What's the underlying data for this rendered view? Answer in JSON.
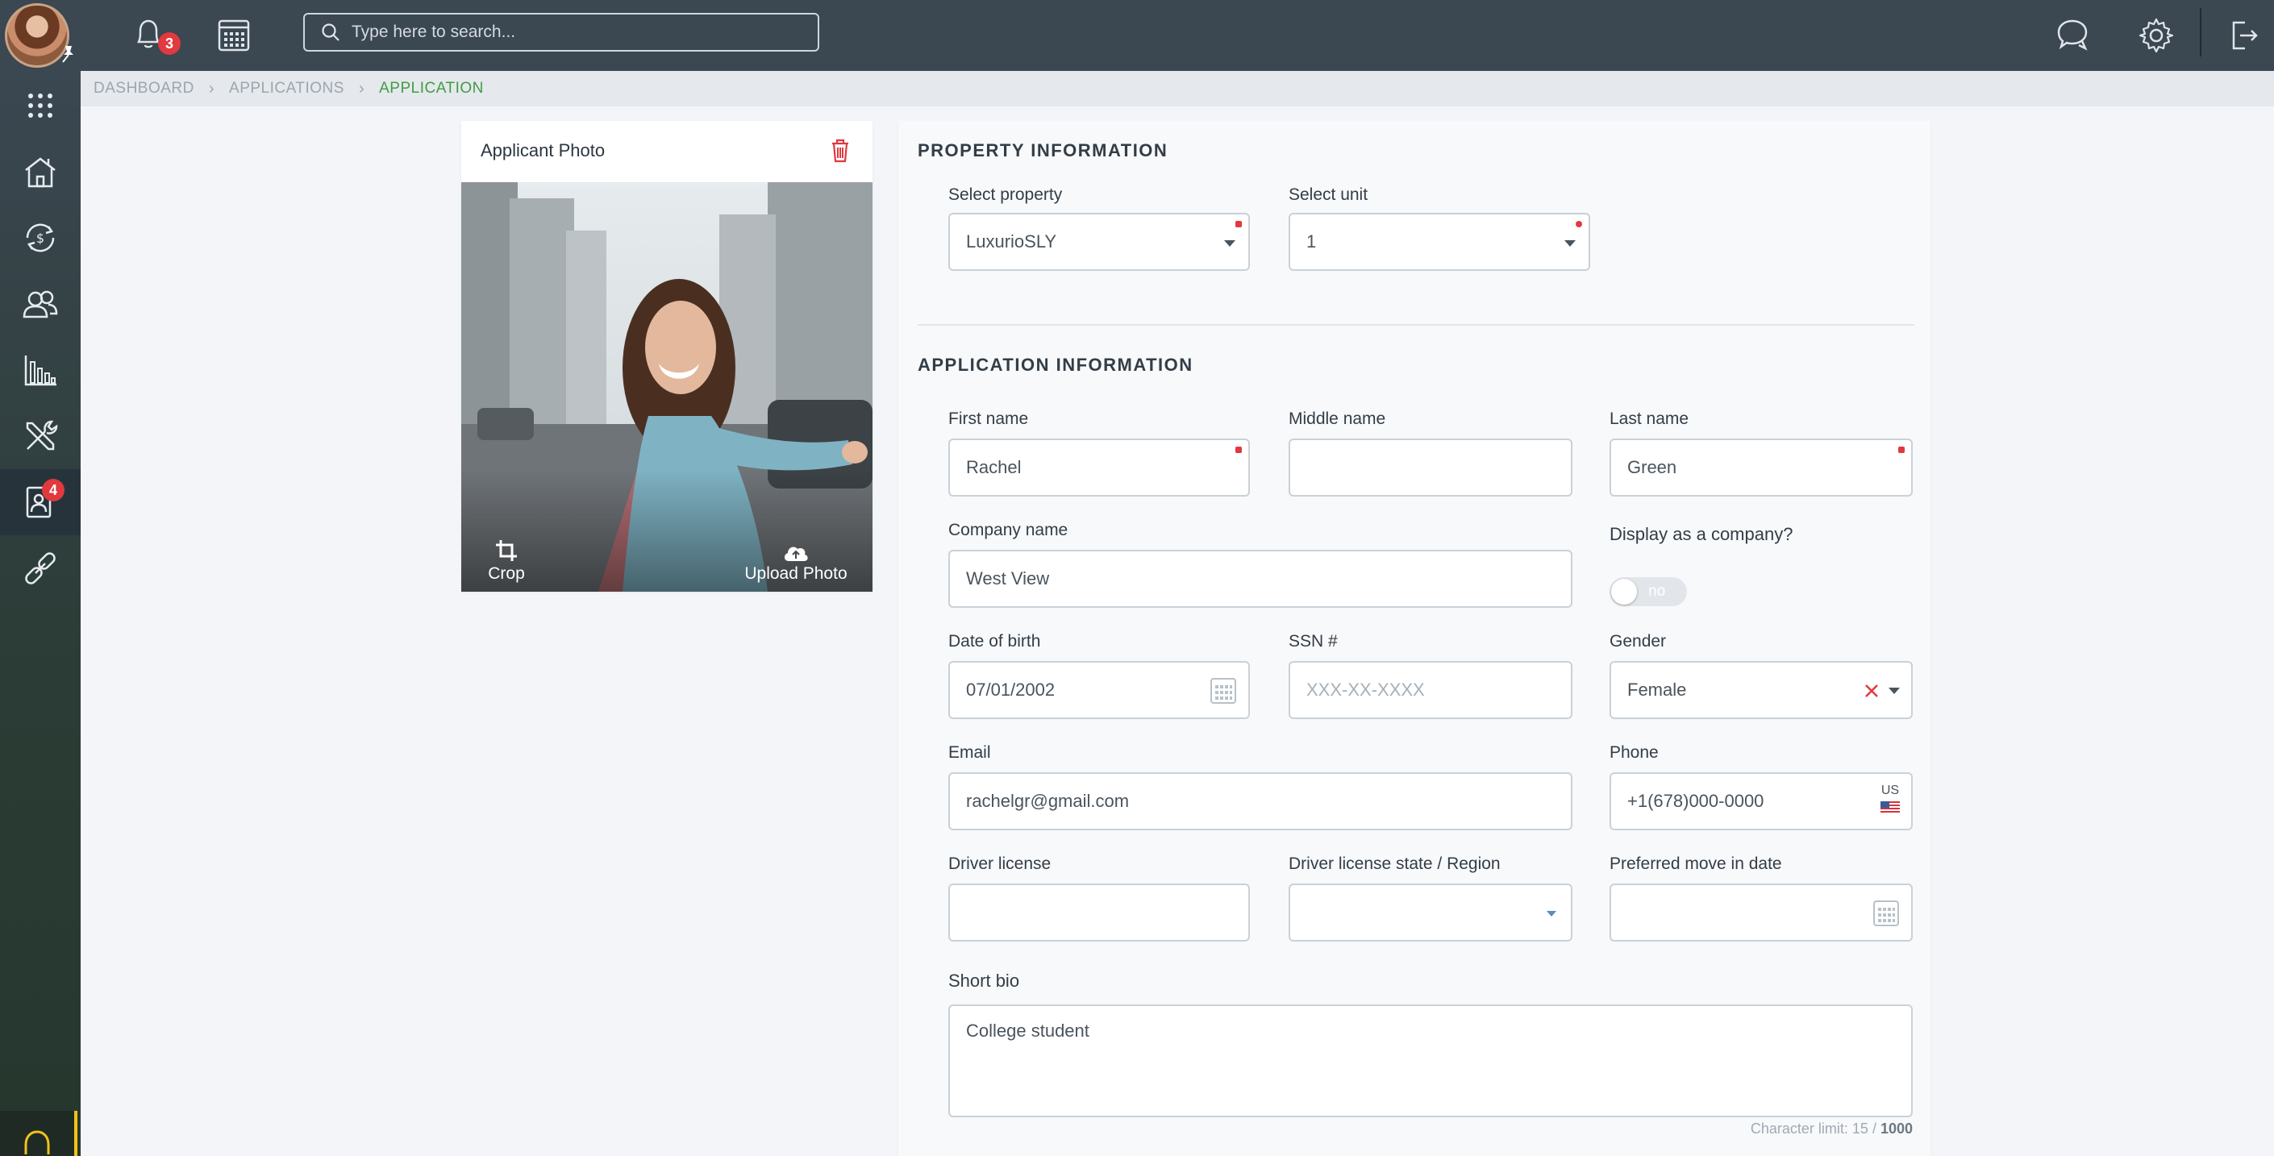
{
  "topbar": {
    "notifications_count": "3",
    "search_placeholder": "Type here to search..."
  },
  "sidebar": {
    "items": [
      {
        "icon": "apps-grid-icon"
      },
      {
        "icon": "property-house-icon"
      },
      {
        "icon": "money-cycle-icon"
      },
      {
        "icon": "users-icon"
      },
      {
        "icon": "reports-chart-icon"
      },
      {
        "icon": "tools-icon"
      },
      {
        "icon": "applications-icon",
        "badge": "4"
      },
      {
        "icon": "link-icon"
      }
    ]
  },
  "breadcrumb": {
    "items": [
      "DASHBOARD",
      "APPLICATIONS",
      "APPLICATION"
    ]
  },
  "photo_card": {
    "title": "Applicant Photo",
    "crop_label": "Crop",
    "upload_label": "Upload Photo"
  },
  "property_info": {
    "title": "PROPERTY INFORMATION",
    "property_label": "Select property",
    "property_value": "LuxurioSLY",
    "unit_label": "Select unit",
    "unit_value": "1"
  },
  "application_info": {
    "title": "APPLICATION INFORMATION",
    "first_name_label": "First name",
    "first_name_value": "Rachel",
    "middle_name_label": "Middle name",
    "middle_name_value": "",
    "last_name_label": "Last name",
    "last_name_value": "Green",
    "company_label": "Company name",
    "company_value": "West View",
    "display_company_label": "Display as a company?",
    "display_company_toggle": "no",
    "dob_label": "Date of birth",
    "dob_value": "07/01/2002",
    "ssn_label": "SSN #",
    "ssn_placeholder": "XXX-XX-XXXX",
    "gender_label": "Gender",
    "gender_value": "Female",
    "email_label": "Email",
    "email_value": "rachelgr@gmail.com",
    "phone_label": "Phone",
    "phone_value": "+1(678)000-0000",
    "phone_country": "US",
    "driver_license_label": "Driver license",
    "driver_license_value": "",
    "dl_state_label": "Driver license state / Region",
    "dl_state_value": "",
    "move_in_label": "Preferred move in date",
    "move_in_value": "",
    "bio_label": "Short bio",
    "bio_value": "College student",
    "char_limit_prefix": "Character limit: 15 / ",
    "char_limit_max": "1000"
  },
  "colors": {
    "topbar": "#3b4751",
    "accent_green": "#3e9d45",
    "required_red": "#e0393e",
    "badge_red": "#e0393e"
  }
}
